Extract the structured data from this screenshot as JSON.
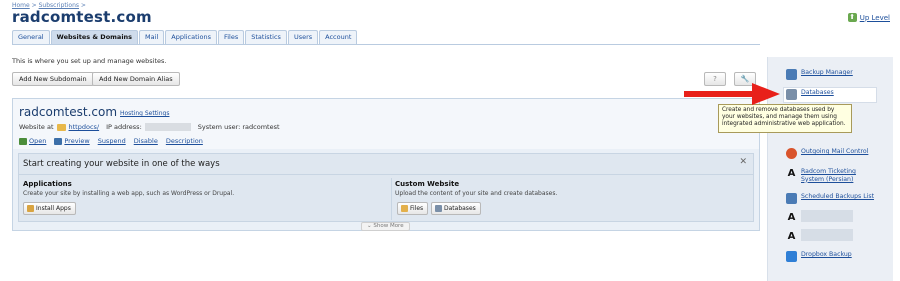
{
  "breadcrumb": {
    "home": "Home",
    "sep": ">",
    "subscriptions": "Subscriptions",
    "sep2": ">"
  },
  "page": {
    "title": "radcomtest.com",
    "up_level": "Up Level"
  },
  "tabs": [
    {
      "label": "General"
    },
    {
      "label": "Websites & Domains",
      "active": true
    },
    {
      "label": "Mail"
    },
    {
      "label": "Applications"
    },
    {
      "label": "Files"
    },
    {
      "label": "Statistics"
    },
    {
      "label": "Users"
    },
    {
      "label": "Account"
    }
  ],
  "intro": "This is where you set up and manage websites.",
  "toolbar": {
    "add_subdomain": "Add New Subdomain",
    "add_alias": "Add New Domain Alias",
    "help": "?",
    "tools": "🔧"
  },
  "domain": {
    "name": "radcomtest.com",
    "hosting_settings": "Hosting Settings",
    "website_at": "Website at",
    "docroot": "httpdocs/",
    "ip_label": "IP address:",
    "system_user": "System user: radcomtest",
    "actions": [
      {
        "label": "Open",
        "icon": "open-icon",
        "color": "#4b8d3a"
      },
      {
        "label": "Preview",
        "icon": "preview-icon",
        "color": "#3c6fa8"
      },
      {
        "label": "Suspend",
        "icon": "",
        "color": ""
      },
      {
        "label": "Disable",
        "icon": "",
        "color": ""
      },
      {
        "label": "Description",
        "icon": "",
        "color": ""
      }
    ]
  },
  "start": {
    "title": "Start creating your website in one of the ways",
    "close": "✕",
    "applications": {
      "heading": "Applications",
      "desc": "Create your site by installing a web app, such as WordPress or Drupal.",
      "button": "Install Apps"
    },
    "custom": {
      "heading": "Custom Website",
      "desc": "Upload the content of your site and create databases.",
      "files_button": "Files",
      "databases_button": "Databases"
    },
    "show_more": "Show More"
  },
  "sidebar": {
    "items": [
      {
        "label": "Backup Manager",
        "icon": "backup-manager-icon",
        "color": "#4a7bb5"
      },
      {
        "label": "Databases",
        "icon": "databases-icon",
        "color": "#7a8fa8"
      },
      {
        "label": "Outgoing Mail Control",
        "icon": "outgoing-mail-icon",
        "color": "#d9542c"
      },
      {
        "label": "Radcom Ticketing System (Persian)",
        "icon": "radcom-icon",
        "color": "#111111"
      },
      {
        "label": "Scheduled Backups List",
        "icon": "scheduled-backups-icon",
        "color": "#4a7bb5"
      },
      {
        "label": "Dropbox Backup",
        "icon": "dropbox-icon",
        "color": "#2f7fd6"
      }
    ]
  },
  "tooltip": "Create and remove databases used by your websites, and manage them using integrated administrative web application.",
  "colors": {
    "accent": "#1d4f9b",
    "title": "#1b3d6e",
    "arrow": "#e8201a",
    "tooltip_bg": "#ffffe1"
  }
}
